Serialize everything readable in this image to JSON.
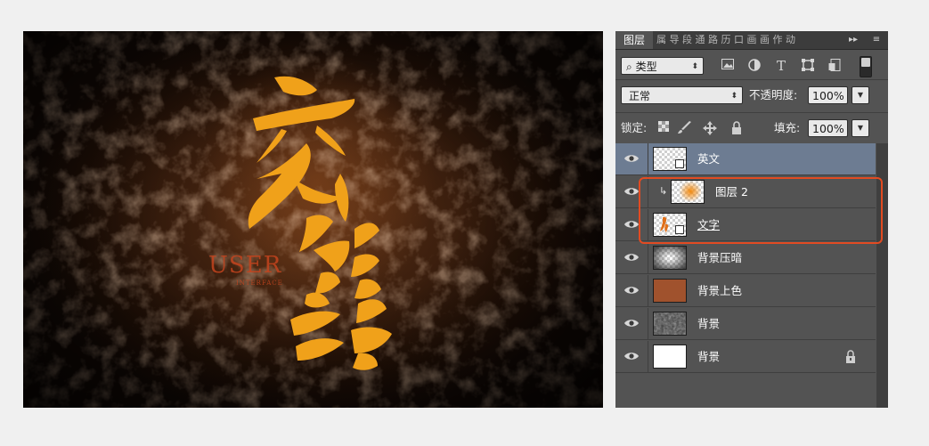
{
  "canvas": {
    "calligraphy_color": "#f0a11a",
    "english_text": "USER",
    "english_subtext": "INTERFACE",
    "english_color": "#c4441e"
  },
  "panel": {
    "active_tab": "图层",
    "collapsed_tabs": "属 导 段 通 路 历 口 画 画 作 动",
    "tab_more": "▸▸",
    "tab_menu": "≡",
    "filter": {
      "icon": "search-icon",
      "value": "类型",
      "filter_icons": [
        "image-filter-icon",
        "adjustment-filter-icon",
        "type-filter-icon",
        "shape-filter-icon",
        "smart-object-filter-icon"
      ]
    },
    "blend_mode": "正常",
    "opacity_label": "不透明度:",
    "opacity_value": "100%",
    "lock_label": "锁定:",
    "lock_icons": [
      "lock-transparent-icon",
      "lock-paint-icon",
      "lock-move-icon",
      "lock-all-icon"
    ],
    "fill_label": "填充:",
    "fill_value": "100%",
    "layers": [
      {
        "name": "英文",
        "thumb": "checker-smart",
        "selected": true
      },
      {
        "name": "图层 2",
        "thumb": "checker-orange",
        "clipped": true
      },
      {
        "name": "文字",
        "thumb": "checker-smart-text",
        "underline": true
      },
      {
        "name": "背景压暗",
        "thumb": "gray-gradient"
      },
      {
        "name": "背景上色",
        "thumb": "solid-brown",
        "color": "#a0522d"
      },
      {
        "name": "背景",
        "thumb": "texture"
      },
      {
        "name": "背景",
        "thumb": "white",
        "locked": true
      }
    ]
  },
  "colors": {
    "panel_bg": "#535353",
    "selected_layer": "#6d7c92",
    "highlight_border": "#e24b22"
  }
}
